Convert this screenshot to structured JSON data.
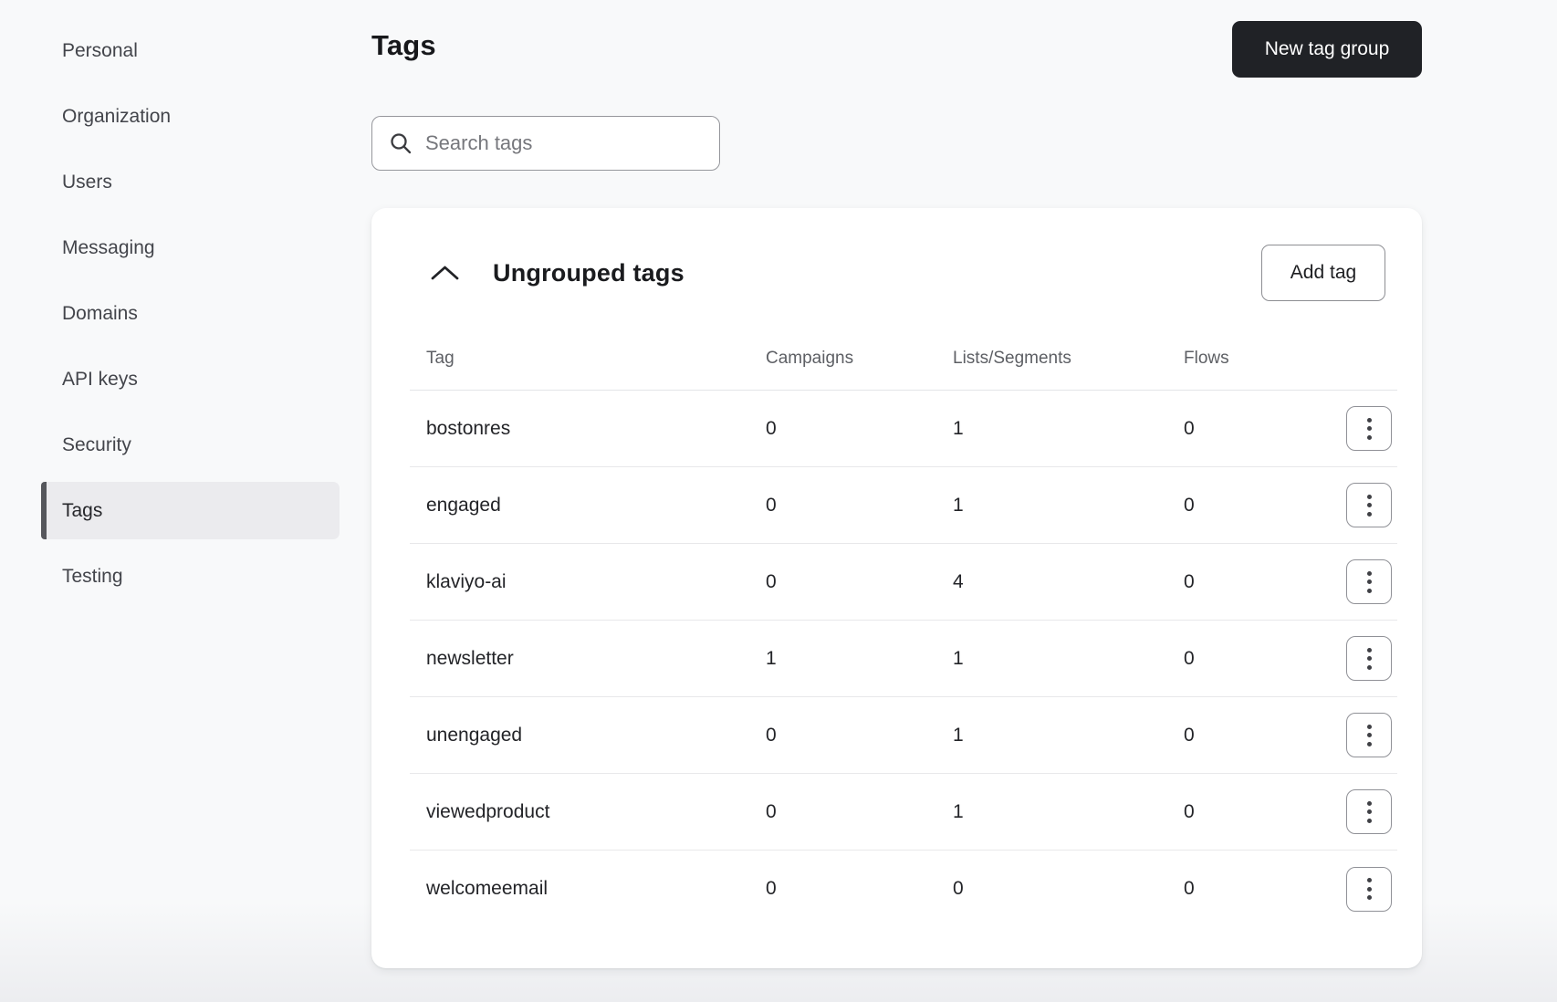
{
  "sidebar": {
    "selected_index": 7,
    "items": [
      {
        "label": "Personal"
      },
      {
        "label": "Organization"
      },
      {
        "label": "Users"
      },
      {
        "label": "Messaging"
      },
      {
        "label": "Domains"
      },
      {
        "label": "API keys"
      },
      {
        "label": "Security"
      },
      {
        "label": "Tags"
      },
      {
        "label": "Testing"
      }
    ]
  },
  "header": {
    "title": "Tags",
    "new_tag_group_label": "New tag group"
  },
  "search": {
    "placeholder": "Search tags",
    "icon": "search-icon"
  },
  "group_card": {
    "title": "Ungrouped tags",
    "collapse_icon": "chevron-up-icon",
    "add_tag_label": "Add tag",
    "row_action_icon": "kebab-menu-icon",
    "table": {
      "columns": {
        "tag": "Tag",
        "campaigns": "Campaigns",
        "lists_segments": "Lists/Segments",
        "flows": "Flows"
      },
      "rows": [
        {
          "tag": "bostonres",
          "campaigns": "0",
          "lists_segments": "1",
          "flows": "0"
        },
        {
          "tag": "engaged",
          "campaigns": "0",
          "lists_segments": "1",
          "flows": "0"
        },
        {
          "tag": "klaviyo-ai",
          "campaigns": "0",
          "lists_segments": "4",
          "flows": "0"
        },
        {
          "tag": "newsletter",
          "campaigns": "1",
          "lists_segments": "1",
          "flows": "0"
        },
        {
          "tag": "unengaged",
          "campaigns": "0",
          "lists_segments": "1",
          "flows": "0"
        },
        {
          "tag": "viewedproduct",
          "campaigns": "0",
          "lists_segments": "1",
          "flows": "0"
        },
        {
          "tag": "welcomeemail",
          "campaigns": "0",
          "lists_segments": "0",
          "flows": "0"
        }
      ]
    }
  },
  "colors": {
    "page_background": "#f8f9fa",
    "card_background": "#ffffff",
    "primary_button_background": "#202226",
    "primary_button_text": "#ffffff",
    "selected_nav_background": "#ebebee",
    "selected_nav_bar": "#56575c",
    "divider": "#e3e4e7",
    "muted_text": "#5d5f64"
  }
}
